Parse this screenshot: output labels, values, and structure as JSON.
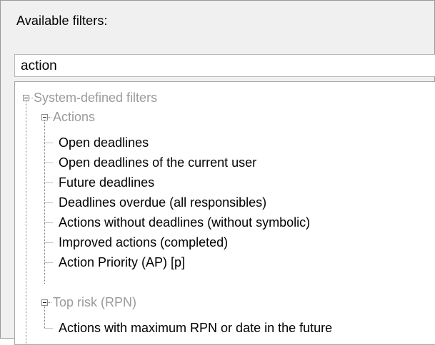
{
  "panel": {
    "label": "Available filters:"
  },
  "search": {
    "value": "action"
  },
  "tree": {
    "root_label": "System-defined filters",
    "groups": [
      {
        "label": "Actions",
        "items": [
          "Open deadlines",
          "Open deadlines of the current user",
          "Future deadlines",
          "Deadlines overdue (all responsibles)",
          "Actions without deadlines (without symbolic)",
          "Improved actions (completed)",
          "Action Priority (AP) [p]"
        ]
      },
      {
        "label": "Top risk (RPN)",
        "items": [
          "Actions with maximum RPN or date in the future"
        ]
      }
    ]
  }
}
